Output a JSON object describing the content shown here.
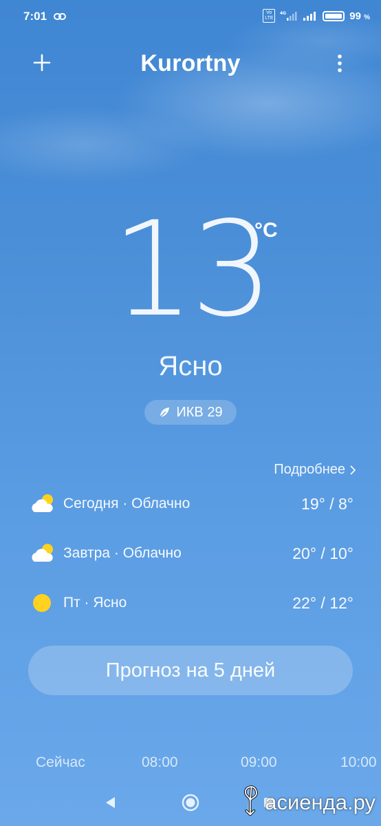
{
  "status_bar": {
    "time": "7:01",
    "network": "4G",
    "volte": "Vo LTE",
    "battery_percent": "99",
    "battery_unit": "%"
  },
  "header": {
    "city": "Kurortny",
    "add_icon": "plus-icon",
    "menu_icon": "more-vertical-icon"
  },
  "current": {
    "temperature": "13",
    "unit": "°C",
    "condition": "Ясно",
    "aqi_label": "ИКВ 29",
    "aqi_icon": "leaf-icon"
  },
  "forecast": {
    "details_label": "Подробнее",
    "days": [
      {
        "label": "Сегодня · Облачно",
        "temps": "19° / 8°",
        "icon": "partly-cloudy-icon"
      },
      {
        "label": "Завтра · Облачно",
        "temps": "20° / 10°",
        "icon": "partly-cloudy-icon"
      },
      {
        "label": "Пт · Ясно",
        "temps": "22° / 12°",
        "icon": "sun-icon"
      }
    ],
    "five_day_label": "Прогноз на 5 дней"
  },
  "hourly": {
    "hours": [
      "Сейчас",
      "08:00",
      "09:00",
      "10:00"
    ]
  },
  "watermark": {
    "text": "асиенда.ру"
  },
  "colors": {
    "sky_top": "#3f86d3",
    "sky_bottom": "#6aa8ea",
    "sun": "#ffd21f"
  }
}
